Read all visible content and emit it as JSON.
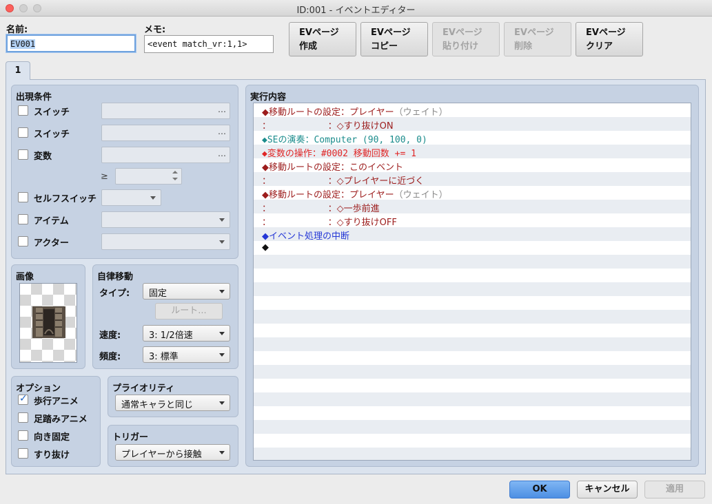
{
  "window": {
    "title": "ID:001 - イベントエディター"
  },
  "header": {
    "name_label": "名前:",
    "name_value": "EV001",
    "memo_label": "メモ:",
    "memo_value": "<event match_vr:1,1>"
  },
  "toolbar": {
    "buttons": [
      {
        "line1": "EVページ",
        "line2": "作成",
        "enabled": true
      },
      {
        "line1": "EVページ",
        "line2": "コピー",
        "enabled": true
      },
      {
        "line1": "EVページ",
        "line2": "貼り付け",
        "enabled": false
      },
      {
        "line1": "EVページ",
        "line2": "削除",
        "enabled": false
      },
      {
        "line1": "EVページ",
        "line2": "クリア",
        "enabled": true
      }
    ]
  },
  "tabs": [
    {
      "label": "1",
      "active": true
    }
  ],
  "conditions": {
    "title": "出現条件",
    "switch1_label": "スイッチ",
    "switch2_label": "スイッチ",
    "variable_label": "変数",
    "dots": "…",
    "gte": "≥",
    "self_switch_label": "セルフスイッチ",
    "item_label": "アイテム",
    "actor_label": "アクター"
  },
  "image": {
    "title": "画像"
  },
  "autonomous": {
    "title": "自律移動",
    "type_label": "タイプ:",
    "type_value": "固定",
    "route_button": "ルート...",
    "speed_label": "速度:",
    "speed_value": "3: 1/2倍速",
    "freq_label": "頻度:",
    "freq_value": "3: 標準"
  },
  "options": {
    "title": "オプション",
    "items": [
      {
        "label": "歩行アニメ",
        "checked": true
      },
      {
        "label": "足踏みアニメ",
        "checked": false
      },
      {
        "label": "向き固定",
        "checked": false
      },
      {
        "label": "すり抜け",
        "checked": false
      }
    ]
  },
  "priority": {
    "title": "プライオリティ",
    "value": "通常キャラと同じ"
  },
  "trigger": {
    "title": "トリガー",
    "value": "プレイヤーから接触"
  },
  "contents": {
    "title": "実行内容",
    "rows": [
      {
        "a": "◆移動ルートの設定：プレイヤー",
        "b": "（ウェイト）"
      },
      {
        "a": "：                    ：◇すり抜けON",
        "b": ""
      },
      {
        "a": "◆SEの演奏：Computer (90, 100, 0)",
        "b": ""
      },
      {
        "a": "◆変数の操作：#0002 移動回数 += 1",
        "b": ""
      },
      {
        "a": "◆移動ルートの設定：このイベント",
        "b": ""
      },
      {
        "a": "：                    ：◇プレイヤーに近づく",
        "b": ""
      },
      {
        "a": "◆移動ルートの設定：プレイヤー",
        "b": "（ウェイト）"
      },
      {
        "a": "：                    ：◇一歩前進",
        "b": ""
      },
      {
        "a": "：                    ：◇すり抜けOFF",
        "b": ""
      },
      {
        "a": "◆イベント処理の中断",
        "b": ""
      },
      {
        "a": "◆",
        "b": ""
      }
    ]
  },
  "footer": {
    "ok": "OK",
    "cancel": "キャンセル",
    "apply": "適用"
  },
  "colors": {
    "route": "#9c1c1c",
    "se": "#1b8c8c",
    "variable": "#e02626",
    "exit": "#2437d6",
    "wait": "#8a8a8a"
  }
}
